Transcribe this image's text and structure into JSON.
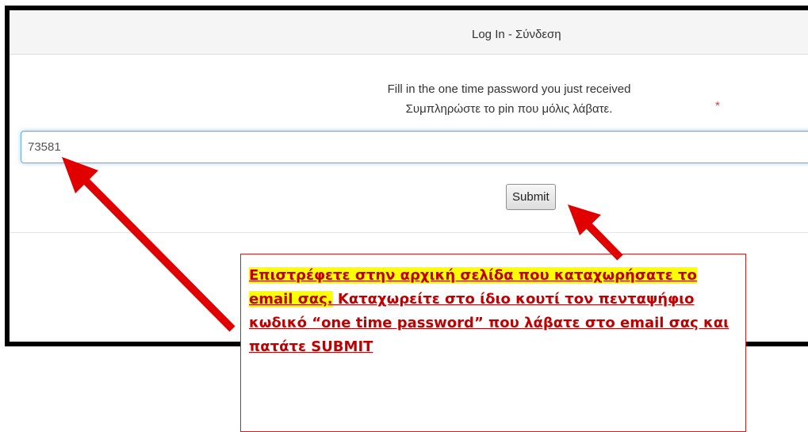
{
  "panel": {
    "title": "Log In - Σύνδεση"
  },
  "form": {
    "prompt_line1": "Fill in the one time password you just received",
    "prompt_line2": "Συμπληρώστε το pin που μόλις λάβατε.",
    "required_marker": "*",
    "otp_value": "73581",
    "submit_label": "Submit"
  },
  "callout": {
    "highlighted_text": "Επιστρέφετε στην αρχική σελίδα που καταχωρήσατε το email σας.",
    "text": "  Καταχωρείτε στο ίδιο κουτί τον πενταψήφιο κωδικό “one time password” που λάβατε στο email σας και πατάτε SUBMIT"
  },
  "colors": {
    "arrow": "#e00000",
    "highlight": "#ffff00",
    "callout_text": "#c00000"
  }
}
